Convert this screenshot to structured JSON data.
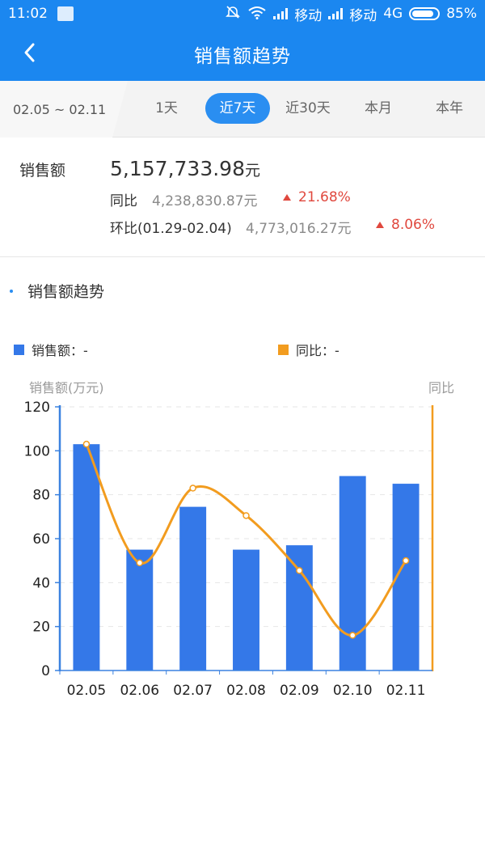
{
  "status_bar": {
    "time": "11:02",
    "carrier1": "移动",
    "carrier2": "移动",
    "network": "4G",
    "battery": "85%"
  },
  "header": {
    "title": "销售额趋势"
  },
  "range": {
    "date_range": "02.05 ~ 02.11",
    "tabs": [
      {
        "label": "1天",
        "active": false
      },
      {
        "label": "近7天",
        "active": true
      },
      {
        "label": "近30天",
        "active": false
      },
      {
        "label": "本月",
        "active": false
      },
      {
        "label": "本年",
        "active": false
      }
    ]
  },
  "summary": {
    "label": "销售额",
    "total": "5,157,733.98",
    "unit": "元",
    "yoy_label": "同比",
    "yoy_value": "4,238,830.87元",
    "yoy_change": "21.68%",
    "mom_label": "环比(01.29-02.04)",
    "mom_value": "4,773,016.27元",
    "mom_change": "8.06%"
  },
  "section": {
    "title": "销售额趋势"
  },
  "legend": {
    "sales": "销售额：-",
    "yoy": "同比：-"
  },
  "colors": {
    "accent": "#1b87f0",
    "bar": "#3478e8",
    "line": "#f29c1f",
    "up": "#e0483e"
  },
  "chart_data": {
    "type": "bar",
    "left_axis_title": "销售额(万元)",
    "right_axis_title": "同比",
    "categories": [
      "02.05",
      "02.06",
      "02.07",
      "02.08",
      "02.09",
      "02.10",
      "02.11"
    ],
    "ylim": [
      0,
      120
    ],
    "yticks": [
      0,
      20,
      40,
      60,
      80,
      100,
      120
    ],
    "grid": true,
    "series": [
      {
        "type": "bar",
        "values": [
          103,
          55,
          74.5,
          55,
          57,
          88.5,
          85
        ]
      },
      {
        "type": "line",
        "smooth": true,
        "values": [
          103,
          49,
          83,
          70.5,
          45.5,
          16,
          50
        ]
      }
    ]
  }
}
